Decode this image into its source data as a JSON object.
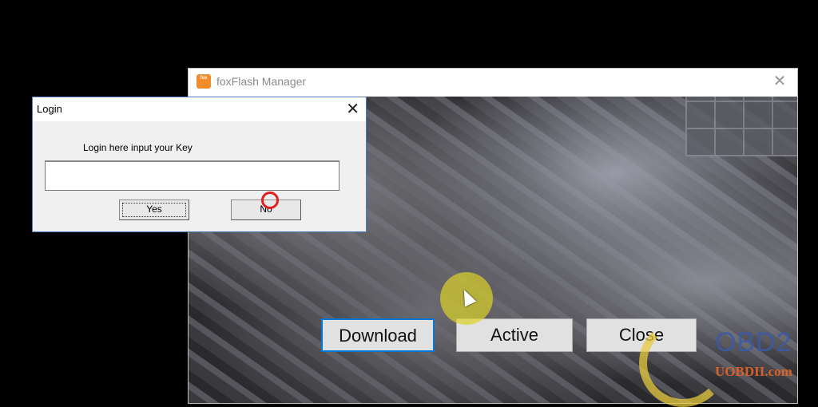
{
  "main_window": {
    "title": "foxFlash Manager",
    "icon": "foxflash-logo-icon",
    "icon_text": "fox",
    "close_glyph": "✕",
    "buttons": {
      "download": "Download",
      "active": "Active",
      "close": "Close"
    },
    "accent_color": "#0078d7"
  },
  "login_dialog": {
    "title": "Login",
    "close_glyph": "✕",
    "prompt": "Login here input your Key",
    "key_input": {
      "value": "",
      "placeholder": ""
    },
    "yes_label": "Yes",
    "no_label": "No"
  },
  "watermark": {
    "brand": "OBD2",
    "url": "UOBDII.com"
  }
}
